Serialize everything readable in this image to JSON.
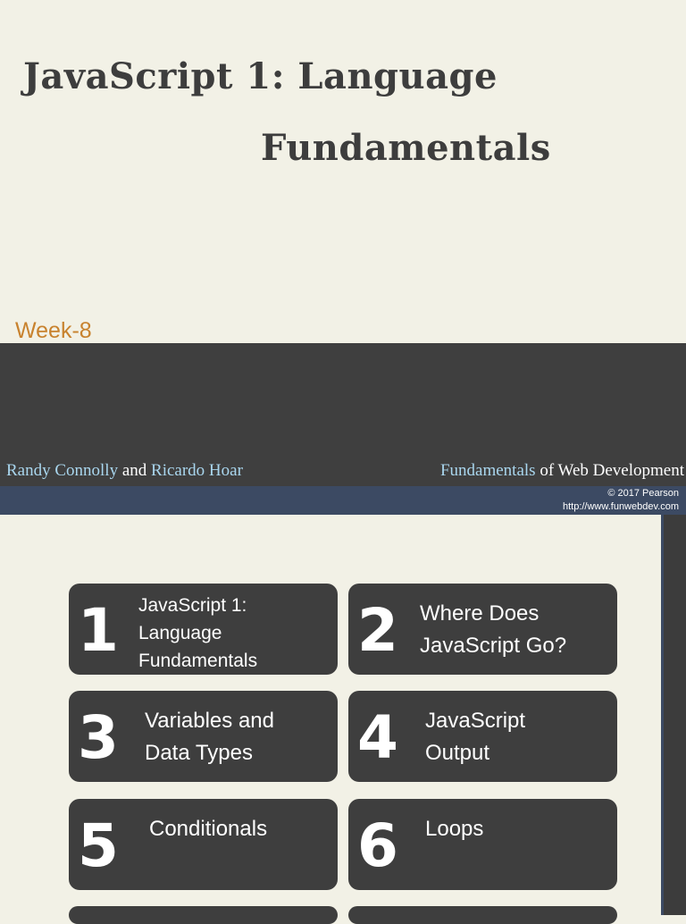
{
  "title_slide": {
    "title_line1": "JavaScript 1: Language",
    "title_line2": "Fundamentals",
    "week": "Week-8",
    "author1": "Randy Connolly",
    "and": " and ",
    "author2": "Ricardo Hoar",
    "book_part1": "Fundamentals",
    "book_part2": " of Web Development",
    "copyright": "© 2017 Pearson",
    "url": "http://www.funwebdev.com"
  },
  "toc": {
    "cards": [
      {
        "num": "1",
        "label": "JavaScript 1:\nLanguage\nFundamentals"
      },
      {
        "num": "2",
        "label": "Where Does\nJavaScript Go?"
      },
      {
        "num": "3",
        "label": "Variables and\nData Types"
      },
      {
        "num": "4",
        "label": "JavaScript\nOutput"
      },
      {
        "num": "5",
        "label": "Conditionals"
      },
      {
        "num": "6",
        "label": "Loops"
      }
    ]
  },
  "colors": {
    "background": "#f2f1e6",
    "dark": "#3f3f3f",
    "navy": "#3c4a63",
    "accent_orange": "#c8822e",
    "accent_blue": "#a9d6ee"
  }
}
